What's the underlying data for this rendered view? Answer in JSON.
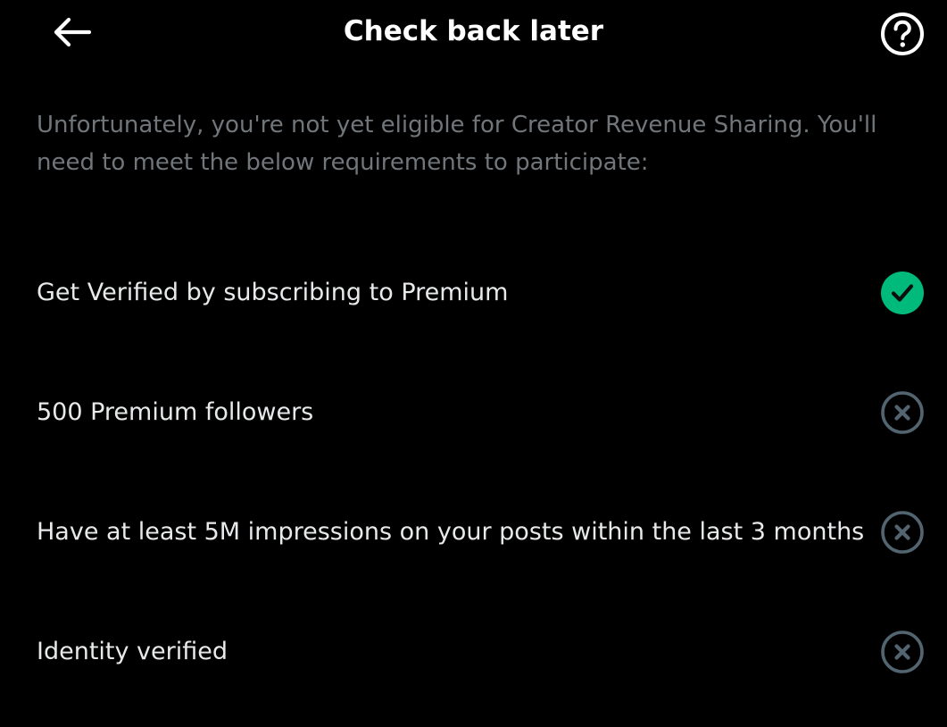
{
  "header": {
    "title": "Check back later",
    "back_icon": "arrow-left-icon",
    "help_icon": "question-circle-icon"
  },
  "intro": "Unfortunately, you're not yet eligible for Creator Revenue Sharing. You'll need to meet the below requirements to participate:",
  "requirements": [
    {
      "label": "Get Verified by subscribing to Premium",
      "status": "met"
    },
    {
      "label": "500 Premium followers",
      "status": "not_met"
    },
    {
      "label": "Have at least 5M impressions on your posts within the last 3 months",
      "status": "not_met"
    },
    {
      "label": "Identity verified",
      "status": "not_met"
    }
  ],
  "colors": {
    "background": "#000000",
    "text": "#e7e9ea",
    "muted": "#71767b",
    "met": "#00ba7c",
    "not_met_ring": "#536471"
  }
}
